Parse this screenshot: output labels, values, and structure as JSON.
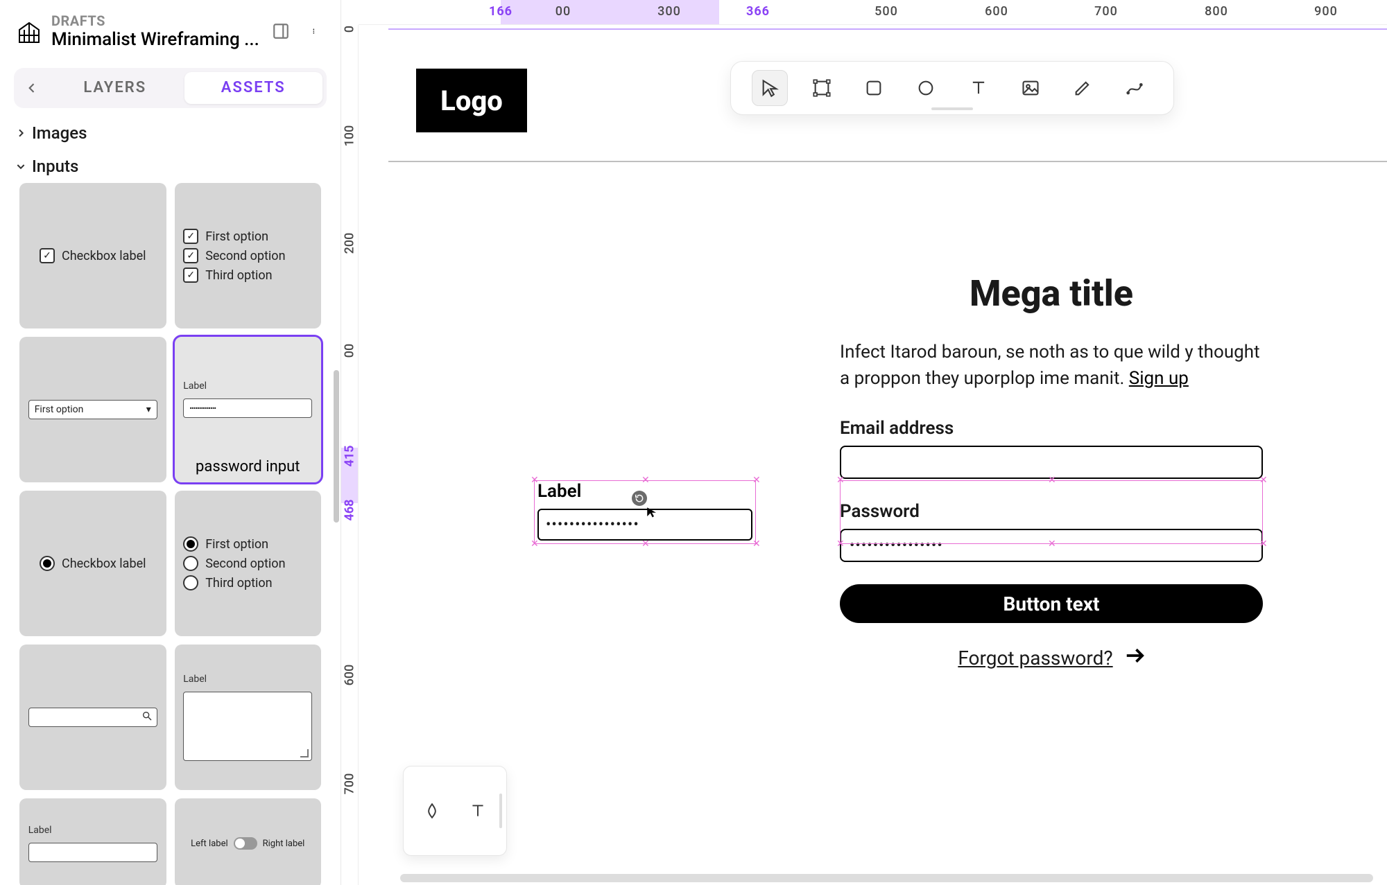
{
  "header": {
    "section_label": "DRAFTS",
    "project_name": "Minimalist Wireframing ..."
  },
  "tabs": {
    "layers": "LAYERS",
    "assets": "ASSETS"
  },
  "tree": {
    "images": "Images",
    "inputs": "Inputs"
  },
  "assets": {
    "checkbox_single_label": "Checkbox label",
    "checkbox_group": {
      "o1": "First option",
      "o2": "Second option",
      "o3": "Third option"
    },
    "select_value": "First option",
    "password_component": {
      "label": "Label",
      "dots": "••••••••••••••",
      "caption": "password input"
    },
    "radio_single_label": "Checkbox label",
    "radio_group": {
      "o1": "First option",
      "o2": "Second option",
      "o3": "Third option"
    },
    "textarea_label": "Label",
    "text_input_label": "Label",
    "toggle": {
      "left": "Left label",
      "right": "Right label"
    }
  },
  "ruler_h": {
    "sel_start": "166",
    "t200": "00",
    "t300": "300",
    "sel_end": "366",
    "t500": "500",
    "t600": "600",
    "t700": "700",
    "t800": "800",
    "t900": "900"
  },
  "ruler_v": {
    "t0": "0",
    "t100": "100",
    "t200": "200",
    "t300": "00",
    "sel_start": "415",
    "sel_end": "468",
    "t600": "600",
    "t700": "700"
  },
  "artboard": {
    "logo": "Logo",
    "mega_title": "Mega title",
    "paragraph_text": "Infect Itarod baroun, se noth as to que wild y thought a proppon they uporplop ime manit.  ",
    "paragraph_link": "Sign up",
    "email_label": "Email address",
    "password_label": "Password",
    "password_dots": "••••••••••••••••",
    "button_text": "Button text",
    "forgot": "Forgot password?"
  },
  "dragged": {
    "label": "Label",
    "dots": "••••••••••••••••"
  }
}
